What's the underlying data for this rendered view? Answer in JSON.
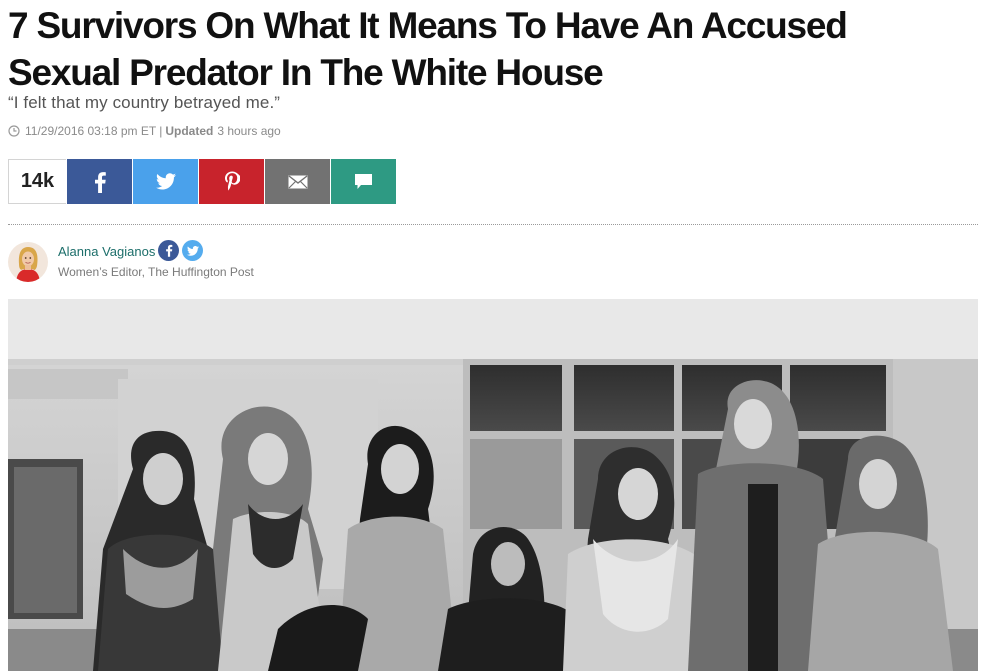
{
  "article": {
    "headline": "7 Survivors On What It Means To Have An Accused Sexual Predator In The White House",
    "subhead": "“I felt that my country betrayed me.”",
    "published": "11/29/2016 03:18 pm ET",
    "separator": "|",
    "updated_label": "Updated",
    "updated_value": "3 hours ago"
  },
  "share": {
    "count": "14k",
    "buttons": [
      {
        "name": "facebook",
        "icon": "facebook-icon",
        "color": "#3b5998"
      },
      {
        "name": "twitter",
        "icon": "twitter-icon",
        "color": "#4aa1eb"
      },
      {
        "name": "pinterest",
        "icon": "pinterest-icon",
        "color": "#c8232c"
      },
      {
        "name": "email",
        "icon": "email-icon",
        "color": "#727272"
      },
      {
        "name": "comment",
        "icon": "comment-icon",
        "color": "#2e9a83"
      }
    ]
  },
  "author": {
    "name": "Alanna Vagianos",
    "title": "Women’s Editor, The Huffington Post",
    "social": [
      {
        "icon": "facebook-icon",
        "color": "#3b5998"
      },
      {
        "icon": "twitter-icon",
        "color": "#55acee"
      }
    ]
  },
  "colors": {
    "headline": "#111111",
    "subhead": "#555555",
    "meta": "#8a8a8a",
    "author_link": "#1c6e6a"
  }
}
